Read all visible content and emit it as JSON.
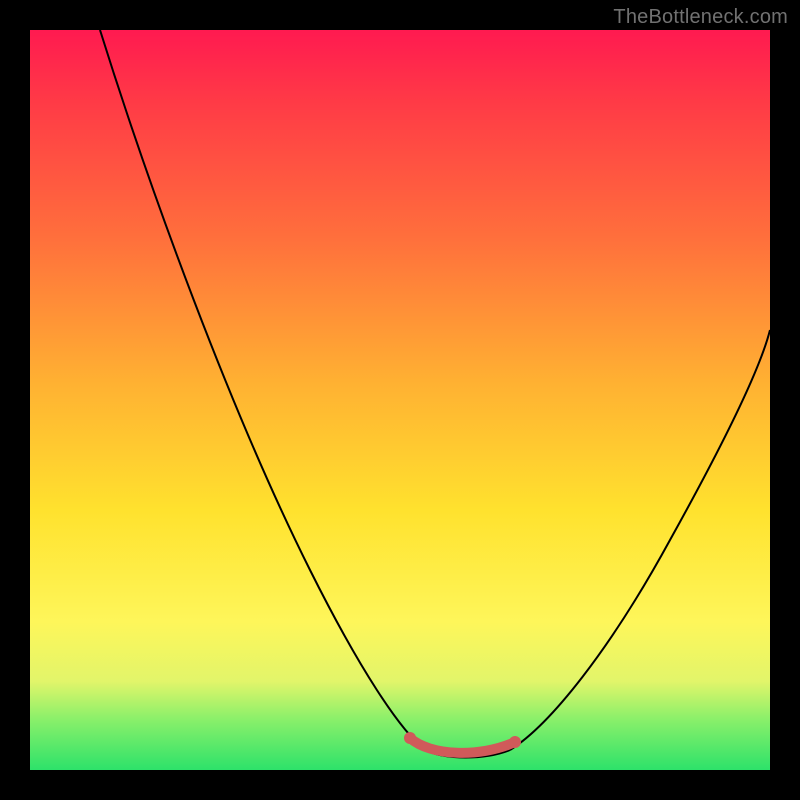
{
  "watermark": "TheBottleneck.com",
  "chart_data": {
    "type": "line",
    "title": "",
    "xlabel": "",
    "ylabel": "",
    "xlim": [
      0,
      100
    ],
    "ylim": [
      0,
      100
    ],
    "grid": false,
    "series": [
      {
        "name": "curve-left",
        "x": [
          10,
          14,
          18,
          22,
          26,
          30,
          34,
          38,
          42,
          46,
          50,
          52
        ],
        "values": [
          100,
          89,
          78,
          67,
          56,
          45,
          35,
          25,
          16,
          8,
          2,
          0
        ]
      },
      {
        "name": "bottom-flat",
        "x": [
          52,
          56,
          60,
          64
        ],
        "values": [
          0,
          0,
          0,
          0
        ]
      },
      {
        "name": "curve-right",
        "x": [
          64,
          68,
          72,
          76,
          80,
          84,
          88,
          92,
          96,
          100
        ],
        "values": [
          0,
          2,
          6,
          12,
          19,
          27,
          36,
          45,
          53,
          60
        ]
      },
      {
        "name": "highlight-band",
        "note": "thick salmon segment near the minimum",
        "x": [
          50,
          53,
          58,
          63,
          65
        ],
        "values": [
          2,
          0,
          0,
          0,
          1
        ]
      }
    ]
  }
}
